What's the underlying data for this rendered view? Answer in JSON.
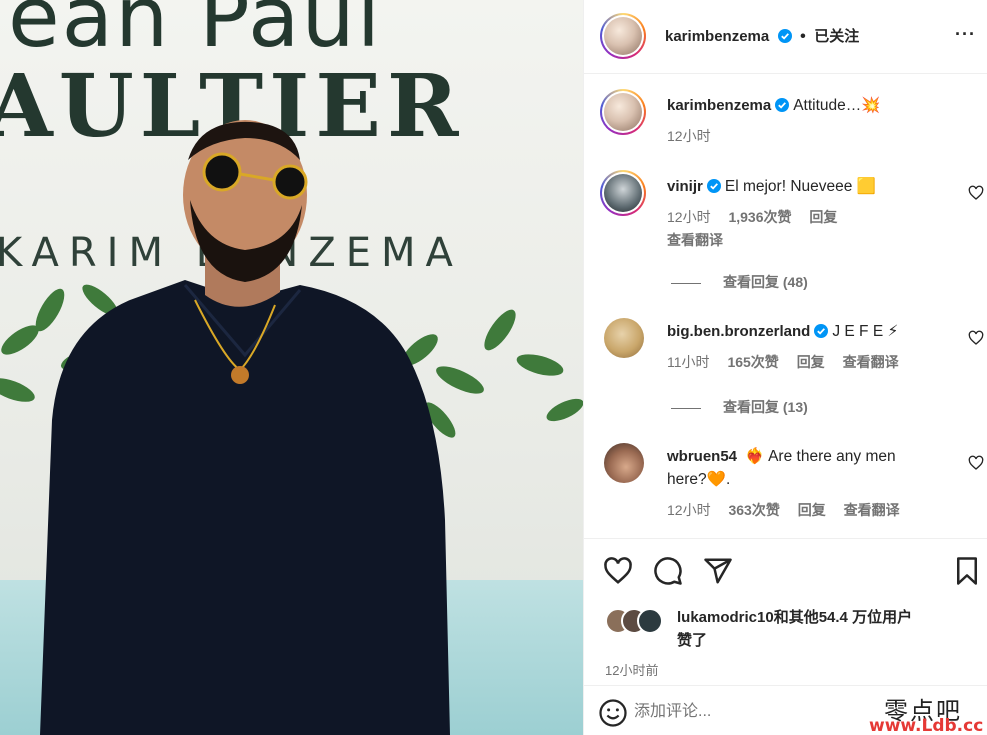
{
  "photo": {
    "brand_line1": "ean Paul",
    "brand_line2": "AULTIER",
    "brand_line3": "KARIM BENZEMA"
  },
  "post_header": {
    "username": "karimbenzema",
    "separator": "•",
    "follow_status": "已关注",
    "more_label": "···"
  },
  "caption": {
    "username": "karimbenzema",
    "text": "Attitude…💥",
    "time": "12小时"
  },
  "comments": [
    {
      "username": "vinijr",
      "verified": true,
      "text": "El mejor! Nueveee 🟨",
      "time": "12小时",
      "likes": "1,936次赞",
      "reply_label": "回复",
      "translate_label": "查看翻译",
      "view_replies": "查看回复 (48)"
    },
    {
      "username": "big.ben.bronzerland",
      "verified": true,
      "text": "J E F E ⚡",
      "time": "11小时",
      "likes": "165次赞",
      "reply_label": "回复",
      "translate_label": "查看翻译",
      "view_replies": "查看回复 (13)"
    },
    {
      "username": "wbruen54",
      "verified": false,
      "text_part1": "❤️‍🔥 Are there any men",
      "text_part2": "here?🧡.",
      "time": "12小时",
      "likes": "363次赞",
      "reply_label": "回复",
      "translate_label": "查看翻译"
    }
  ],
  "actions": {
    "like_icon": "heart-icon",
    "comment_icon": "comment-icon",
    "share_icon": "share-icon",
    "save_icon": "bookmark-icon"
  },
  "likes_summary": {
    "line1": "lukamodric10和其他54.4 万位用户",
    "line2": "赞了"
  },
  "post_time": "12小时前",
  "add_comment": {
    "placeholder": "添加评论..."
  },
  "watermark": {
    "line1": "零点吧",
    "line2": "www.Ldb.cc"
  },
  "colors": {
    "text": "#262626",
    "secondary": "#737373",
    "verified": "#0095f6",
    "border": "#efefef"
  }
}
